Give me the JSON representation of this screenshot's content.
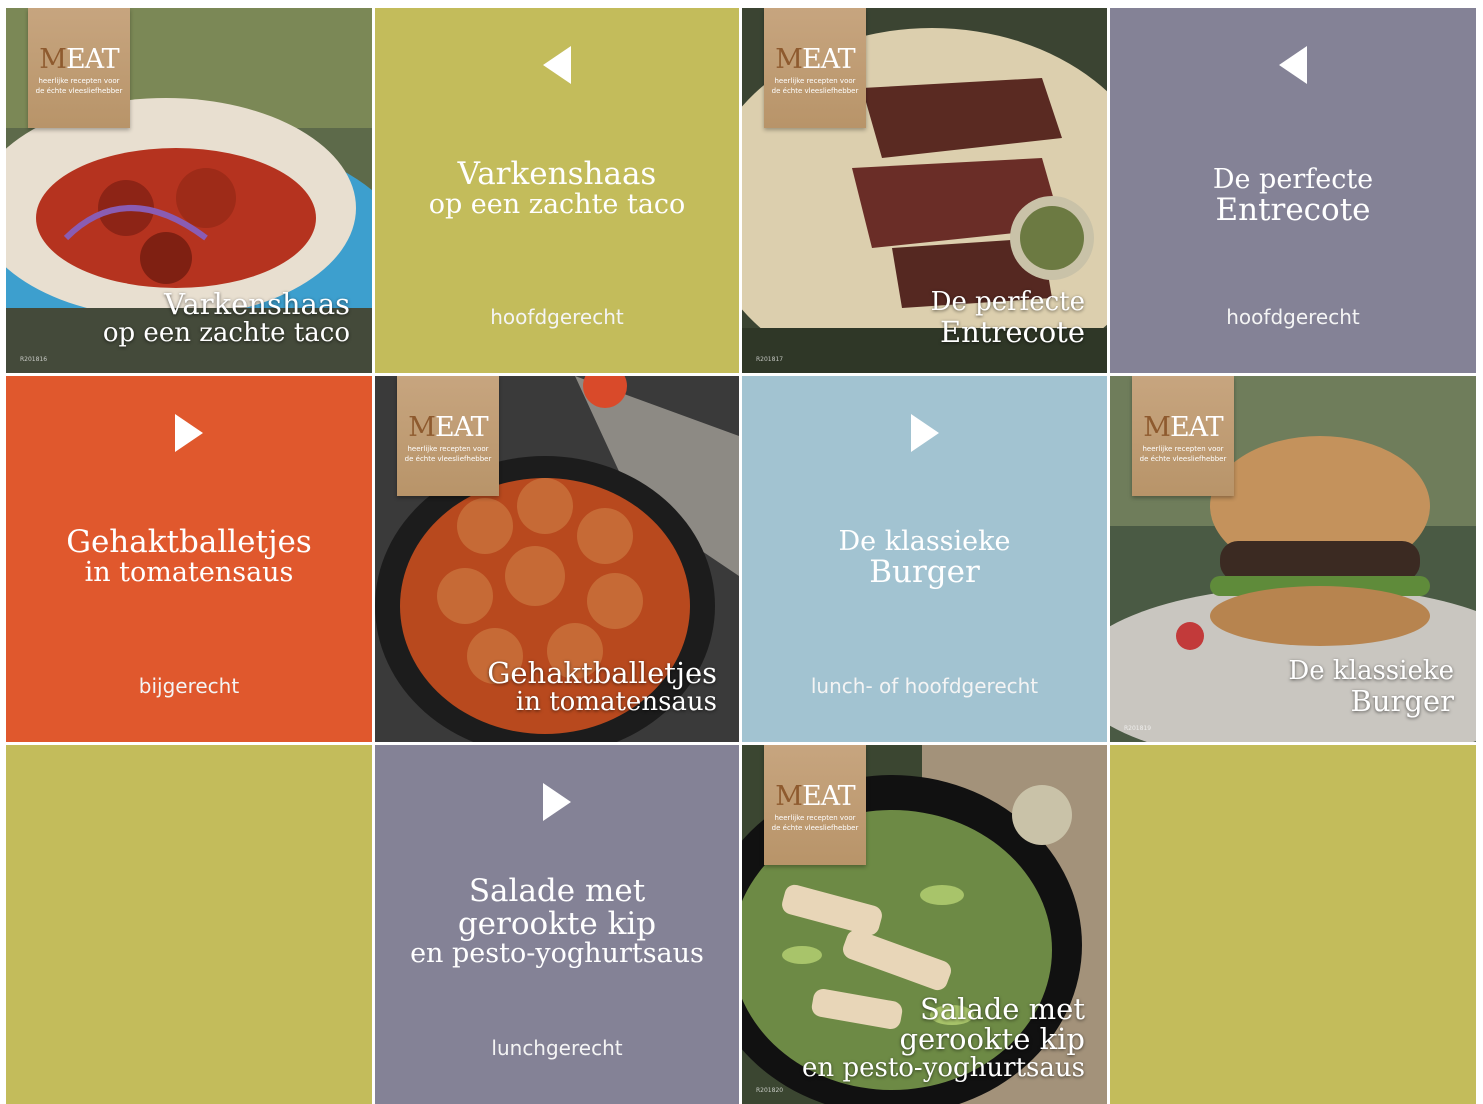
{
  "colors": {
    "olive": "#c3bc5b",
    "slate": "#848296",
    "orange": "#e0582d",
    "lightblue": "#a2c3d1",
    "badge": "#c1a07a"
  },
  "badge": {
    "logo_m": "M",
    "logo_rest": "EAT",
    "tagline_1": "heerlijke recepten voor",
    "tagline_2": "de échte vleesliefhebber"
  },
  "tiles": {
    "t1": {
      "line1": "Varkenshaas",
      "line2": "op een zachte taco",
      "code": "R201816"
    },
    "t2": {
      "line1": "Varkenshaas",
      "line2": "op een zachte taco",
      "category": "hoofdgerecht",
      "arrow": "left-arrow-icon"
    },
    "t3": {
      "line1": "De perfecte",
      "line2": "Entrecote",
      "code": "R201817"
    },
    "t4": {
      "line1": "De perfecte",
      "line2": "Entrecote",
      "category": "hoofdgerecht",
      "arrow": "left-arrow-icon"
    },
    "t5": {
      "line1": "Gehaktballetjes",
      "line2": "in tomatensaus",
      "category": "bijgerecht",
      "arrow": "right-arrow-icon"
    },
    "t6": {
      "line1": "Gehaktballetjes",
      "line2": "in tomatensaus"
    },
    "t7": {
      "line1": "De klassieke",
      "line2": "Burger",
      "category": "lunch- of hoofdgerecht",
      "arrow": "right-arrow-icon"
    },
    "t8": {
      "line1": "De klassieke",
      "line2": "Burger",
      "code": "R201819"
    },
    "t10": {
      "line1": "Salade met",
      "line2": "gerookte kip",
      "line3": "en pesto-yoghurtsaus",
      "category": "lunchgerecht",
      "arrow": "right-arrow-icon"
    },
    "t11": {
      "line1": "Salade met",
      "line2": "gerookte kip",
      "line3": "en pesto-yoghurtsaus",
      "code": "R201820"
    }
  }
}
